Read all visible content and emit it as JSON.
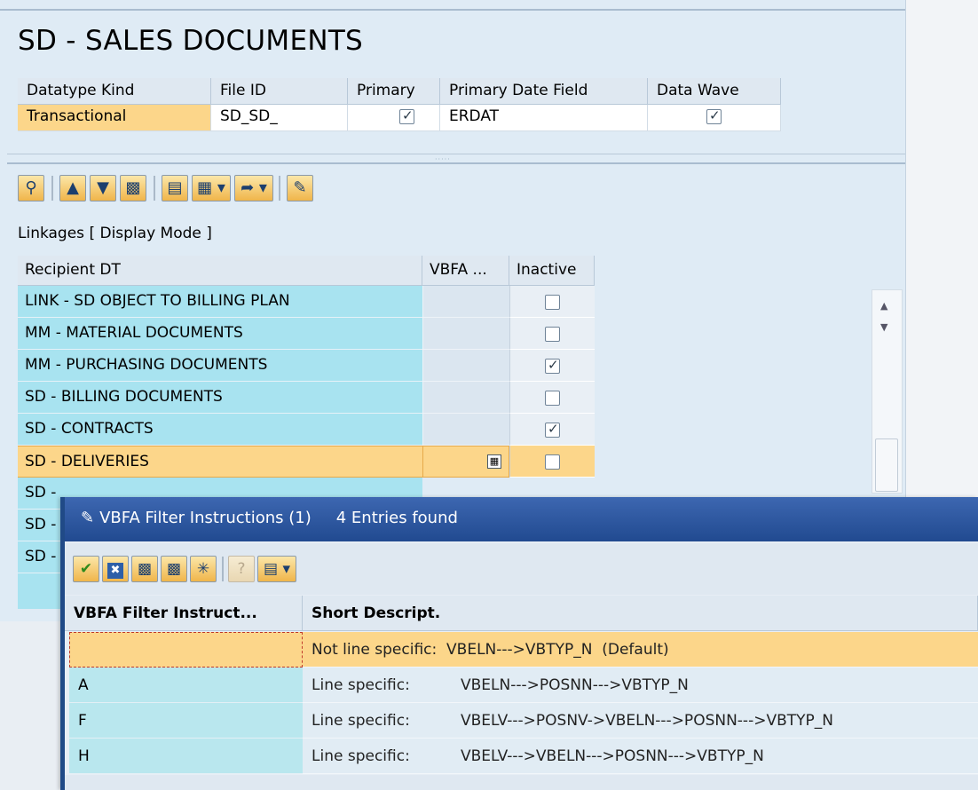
{
  "header": {
    "title": "SD - SALES DOCUMENTS",
    "columns": [
      "Datatype Kind",
      "File ID",
      "Primary",
      "Primary Date Field",
      "Data Wave"
    ],
    "values": {
      "datatype_kind": "Transactional",
      "file_id": "SD_SD_",
      "primary": true,
      "primary_date_field": "ERDAT",
      "data_wave": true
    }
  },
  "toolbar": {
    "buttons": [
      "details-icon",
      "sort-ascending-icon",
      "filter-icon",
      "find-icon",
      "print-icon",
      "layout-icon",
      "export-icon",
      "edit-icon"
    ]
  },
  "linkages": {
    "label": "Linkages [ Display Mode ]",
    "columns": [
      "Recipient DT",
      "VBFA ...",
      "Inactive"
    ],
    "rows": [
      {
        "recipient": "LINK - SD OBJECT TO BILLING PLAN",
        "inactive": false
      },
      {
        "recipient": "MM - MATERIAL DOCUMENTS",
        "inactive": false
      },
      {
        "recipient": "MM - PURCHASING DOCUMENTS",
        "inactive": true
      },
      {
        "recipient": "SD - BILLING DOCUMENTS",
        "inactive": false
      },
      {
        "recipient": "SD - CONTRACTS",
        "inactive": true
      },
      {
        "recipient": "SD - DELIVERIES",
        "inactive": false,
        "selected": true
      },
      {
        "recipient": "SD -"
      },
      {
        "recipient": "SD -"
      },
      {
        "recipient": "SD -"
      }
    ]
  },
  "dialog": {
    "title": "VBFA Filter Instructions (1)",
    "entries_found": "4 Entries found",
    "toolbar": [
      "check-icon",
      "cancel-icon",
      "find-icon",
      "find-next-icon",
      "new-icon",
      "help-icon",
      "print-icon"
    ],
    "columns": [
      "VBFA Filter Instruct...",
      "Short Descript."
    ],
    "rows": [
      {
        "key": "",
        "label": "Not line specific:",
        "desc": "VBELN--->VBTYP_N  (Default)",
        "selected": true
      },
      {
        "key": "A",
        "label": "Line specific:",
        "desc": "VBELN--->POSNN--->VBTYP_N"
      },
      {
        "key": "F",
        "label": "Line specific:",
        "desc": "VBELV--->POSNV->VBELN--->POSNN--->VBTYP_N"
      },
      {
        "key": "H",
        "label": "Line specific:",
        "desc": "VBELV--->VBELN--->POSNN--->VBTYP_N"
      }
    ]
  }
}
